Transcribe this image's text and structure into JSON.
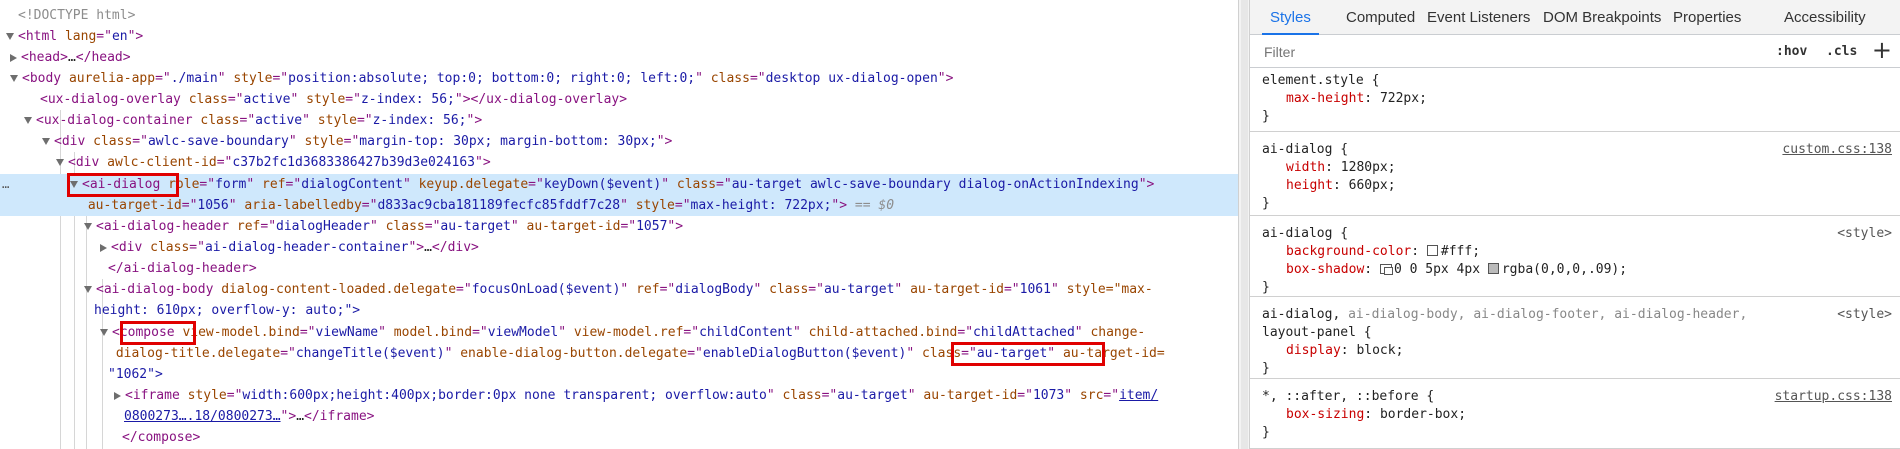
{
  "elements": {
    "lines": [
      {
        "t": "doctype",
        "text": "<!DOCTYPE html>"
      },
      {
        "t": "html_open",
        "tag": "html",
        "attrs": [
          {
            "n": "lang",
            "v": "en"
          }
        ]
      },
      {
        "t": "head",
        "tag": "head",
        "ellipsis": "…"
      },
      {
        "t": "body",
        "tag": "body",
        "attrs": [
          {
            "n": "aurelia-app",
            "v": "./main"
          },
          {
            "n": "style",
            "v": "position:absolute; top:0; bottom:0; right:0; left:0;"
          },
          {
            "n": "class",
            "v": "desktop ux-dialog-open"
          }
        ]
      },
      {
        "t": "overlay",
        "tag": "ux-dialog-overlay",
        "attrs": [
          {
            "n": "class",
            "v": "active"
          },
          {
            "n": "style",
            "v": "z-index: 56;"
          }
        ]
      },
      {
        "t": "container",
        "tag": "ux-dialog-container",
        "attrs": [
          {
            "n": "class",
            "v": "active"
          },
          {
            "n": "style",
            "v": "z-index: 56;"
          }
        ]
      },
      {
        "t": "savediv",
        "tag": "div",
        "attrs": [
          {
            "n": "class",
            "v": "awlc-save-boundary"
          },
          {
            "n": "style",
            "v": "margin-top: 30px; margin-bottom: 30px;"
          }
        ]
      },
      {
        "t": "clientdiv",
        "tag": "div",
        "attrs": [
          {
            "n": "awlc-client-id",
            "v": "c37b2fc1d3683386427b39d3e024163"
          }
        ]
      },
      {
        "t": "dialog1",
        "tag": "ai-dialog",
        "attrs": [
          {
            "n": "role",
            "v": "form"
          },
          {
            "n": "ref",
            "v": "dialogContent"
          },
          {
            "n": "keyup.delegate",
            "v": "keyDown($event)"
          },
          {
            "n": "class",
            "v": "au-target awlc-save-boundary dialog-onActionIndexing"
          }
        ]
      },
      {
        "t": "dialog2",
        "attrs": [
          {
            "n": "au-target-id",
            "v": "1056"
          },
          {
            "n": "aria-labelledby",
            "v": "d833ac9cba181189fecfc85fddf7c28"
          },
          {
            "n": "style",
            "v": "max-height: 722px;"
          }
        ],
        "suffix": "== $0"
      },
      {
        "t": "header",
        "tag": "ai-dialog-header",
        "attrs": [
          {
            "n": "ref",
            "v": "dialogHeader"
          },
          {
            "n": "class",
            "v": "au-target"
          },
          {
            "n": "au-target-id",
            "v": "1057"
          }
        ]
      },
      {
        "t": "headerdiv",
        "tag": "div",
        "attrs": [
          {
            "n": "class",
            "v": "ai-dialog-header-container"
          }
        ],
        "ellipsis": "…"
      },
      {
        "t": "headerclose",
        "tag": "ai-dialog-header"
      },
      {
        "t": "body1",
        "tag": "ai-dialog-body",
        "attrs": [
          {
            "n": "dialog-content-loaded.delegate",
            "v": "focusOnLoad($event)"
          },
          {
            "n": "ref",
            "v": "dialogBody"
          },
          {
            "n": "class",
            "v": "au-target"
          },
          {
            "n": "au-target-id",
            "v": "1061"
          }
        ],
        "tail": "style=\"max-"
      },
      {
        "t": "body2",
        "text": "height: 610px; overflow-y: auto;\">"
      },
      {
        "t": "compose1",
        "tag": "compose",
        "attrs": [
          {
            "n": "view-model.bind",
            "v": "viewName"
          },
          {
            "n": "model.bind",
            "v": "viewModel"
          },
          {
            "n": "view-model.ref",
            "v": "childContent"
          },
          {
            "n": "child-attached.bind",
            "v": "childAttached"
          }
        ],
        "tail": "change-"
      },
      {
        "t": "compose2",
        "attrs": [
          {
            "n": "dialog-title.delegate",
            "v": "changeTitle($event)"
          },
          {
            "n": "enable-dialog-button.delegate",
            "v": "enableDialogButton($event)"
          },
          {
            "n": "class",
            "v": "au-target"
          }
        ],
        "tail": "au-target-id="
      },
      {
        "t": "compose3",
        "text": "\"1062\">"
      },
      {
        "t": "iframe1",
        "tag": "iframe",
        "attrs": [
          {
            "n": "style",
            "v": "width:600px;height:400px;border:0px none transparent; overflow:auto"
          },
          {
            "n": "class",
            "v": "au-target"
          },
          {
            "n": "au-target-id",
            "v": "1073"
          }
        ],
        "tail_attr": "src",
        "link_start": "item/"
      },
      {
        "t": "iframe2",
        "link": "0800273….18/0800273…",
        "ellipsis": "…",
        "close": "iframe"
      },
      {
        "t": "composeclose",
        "tag": "compose"
      }
    ],
    "more_icon": "⋯"
  },
  "styles": {
    "tabs": [
      "Styles",
      "Computed",
      "Event Listeners",
      "DOM Breakpoints",
      "Properties",
      "Accessibility"
    ],
    "filter_placeholder": "Filter",
    "hov": ":hov",
    "cls": ".cls",
    "plus": "+",
    "rules": [
      {
        "selector": "element.style {",
        "source": "",
        "props": [
          {
            "name": "max-height",
            "value": "722px;"
          }
        ]
      },
      {
        "selector": "ai-dialog {",
        "source": "custom.css:138",
        "props": [
          {
            "name": "width",
            "value": "1280px;"
          },
          {
            "name": "height",
            "value": "660px;"
          }
        ]
      },
      {
        "selector": "ai-dialog {",
        "source": "<style>",
        "props": [
          {
            "name": "background-color",
            "value": "#fff;",
            "swatch": "white"
          },
          {
            "name": "box-shadow",
            "value": "0 0 5px 4px",
            "swatch": "shadow",
            "value2": "rgba(0,0,0,.09);"
          }
        ]
      },
      {
        "selector": "ai-dialog,",
        "selector_dim": " ai-dialog-body, ai-dialog-footer, ai-dialog-header,",
        "selector_line2": "layout-panel {",
        "source": "<style>",
        "props": [
          {
            "name": "display",
            "value": "block;"
          }
        ]
      },
      {
        "selector": "*, ::after, ::before {",
        "source": "startup.css:138",
        "props": [
          {
            "name": "box-sizing",
            "value": "border-box;"
          }
        ]
      }
    ],
    "close_brace": "}",
    "colors": {
      "accent": "#1a73e8",
      "selected_row": "#cfe8fc",
      "tag": "#881280",
      "attr_name": "#994500",
      "attr_value": "#1a1aa6",
      "prop_name": "#c80000",
      "highlight_box": "#e00000"
    }
  }
}
